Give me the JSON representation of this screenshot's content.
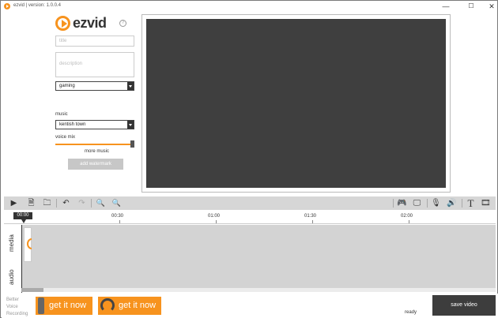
{
  "window": {
    "title": "ezvid | version: 1.0.0.4",
    "minimize_glyph": "—",
    "maximize_glyph": "☐",
    "close_glyph": "✕"
  },
  "sidebar": {
    "logo_text": "ezvid",
    "help_glyph": "?",
    "title_placeholder": "title",
    "description_placeholder": "description",
    "category_value": "gaming",
    "music_label": "music",
    "music_value": "kentish town",
    "voice_mix_label": "voice mix",
    "voice_mix_level": 1.0,
    "more_music_label": "more music",
    "watermark_button_label": "add watermark"
  },
  "toolbar": {
    "play_glyph": "▶",
    "add_media_glyph": "🗎",
    "open_folder_glyph": "🗀",
    "undo_glyph": "↶",
    "redo_glyph": "↷",
    "zoom_out_glyph": "🔍",
    "zoom_in_glyph": "🔍",
    "gamepad_glyph": "🎮",
    "screen_capture_glyph": "🖵",
    "microphone_glyph": "🎙",
    "speech_glyph": "🔊",
    "text_glyph": "T",
    "film_glyph": "🎞"
  },
  "timeline": {
    "playhead_time": "00:00",
    "ruler_labels": [
      "00:30",
      "01:00",
      "01:30",
      "02:00"
    ],
    "track_media_label": "media",
    "track_audio_label": "audio"
  },
  "bottom": {
    "promo_text_line1": "Better",
    "promo_text_line2": "Voice",
    "promo_text_line3": "Recording",
    "promo1_label": "get it now",
    "promo2_label": "get it now",
    "status": "ready",
    "save_button_label": "save video"
  },
  "colors": {
    "accent": "#f7931e",
    "preview_bg": "#3f3f3f",
    "toolbar_bg": "#d6d6d6",
    "save_button_bg": "#3d3d3d"
  }
}
